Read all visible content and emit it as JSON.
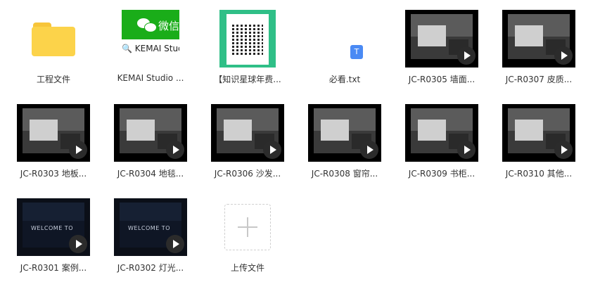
{
  "items": [
    {
      "label": "工程文件",
      "kind": "folder",
      "icon": "folder-icon"
    },
    {
      "label": "KEMAI Studio ...",
      "kind": "wechat",
      "thumb_title": "微信",
      "thumb_text": "KEMAI Studio"
    },
    {
      "label": "【知识星球年费...",
      "kind": "qr",
      "icon": "qr-code-icon"
    },
    {
      "label": "必看.txt",
      "kind": "txt",
      "badge": "T"
    },
    {
      "label": "JC-R0305 墙面...",
      "kind": "video"
    },
    {
      "label": "JC-R0307 皮质...",
      "kind": "video"
    },
    {
      "label": "JC-R0303 地板...",
      "kind": "video"
    },
    {
      "label": "JC-R0304 地毯...",
      "kind": "video"
    },
    {
      "label": "JC-R0306 沙发...",
      "kind": "video"
    },
    {
      "label": "JC-R0308 窗帘...",
      "kind": "video"
    },
    {
      "label": "JC-R0309 书柜...",
      "kind": "video"
    },
    {
      "label": "JC-R0310 其他...",
      "kind": "video"
    },
    {
      "label": "JC-R0301 案例...",
      "kind": "welcome",
      "thumb_text": "WELCOME TO"
    },
    {
      "label": "JC-R0302 灯光...",
      "kind": "welcome",
      "thumb_text": "WELCOME TO"
    },
    {
      "label": "上传文件",
      "kind": "upload"
    }
  ]
}
